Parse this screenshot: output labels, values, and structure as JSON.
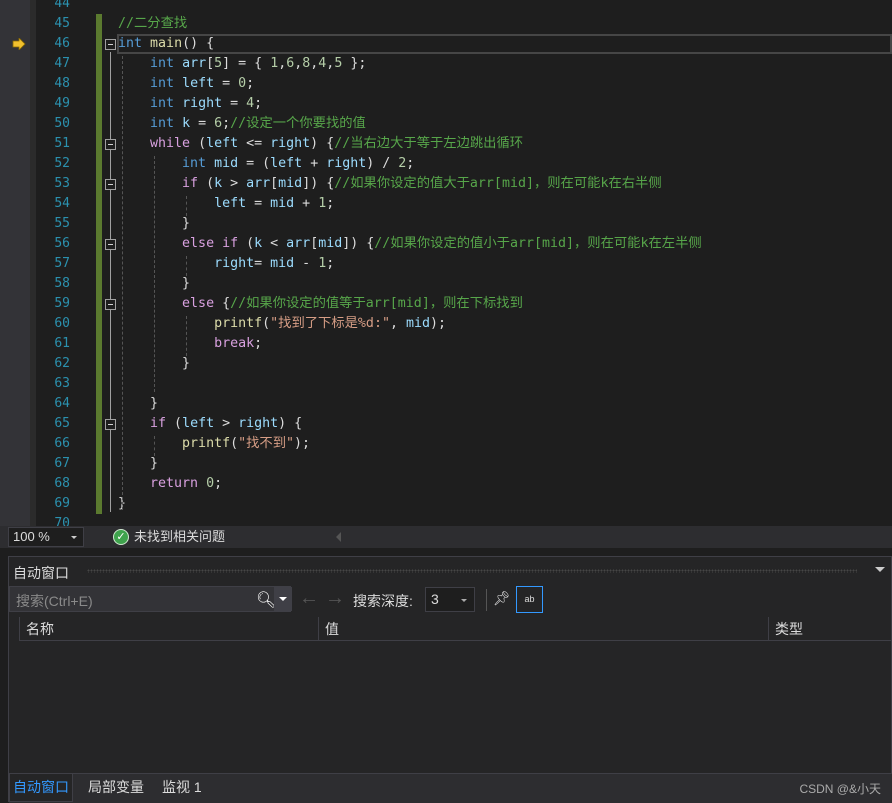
{
  "editor": {
    "first_line": 44,
    "current_line": 46,
    "lines": [
      [],
      [
        [
          "m",
          "//二分查找"
        ]
      ],
      [
        [
          "k",
          "int"
        ],
        [
          "p",
          " "
        ],
        [
          "f",
          "main"
        ],
        [
          "p",
          "() {"
        ]
      ],
      [
        [
          "p",
          "    "
        ],
        [
          "k",
          "int"
        ],
        [
          "p",
          " "
        ],
        [
          "v",
          "arr"
        ],
        [
          "p",
          "["
        ],
        [
          "n",
          "5"
        ],
        [
          "p",
          "] = { "
        ],
        [
          "n",
          "1"
        ],
        [
          "p",
          ","
        ],
        [
          "n",
          "6"
        ],
        [
          "p",
          ","
        ],
        [
          "n",
          "8"
        ],
        [
          "p",
          ","
        ],
        [
          "n",
          "4"
        ],
        [
          "p",
          ","
        ],
        [
          "n",
          "5"
        ],
        [
          "p",
          " };"
        ]
      ],
      [
        [
          "p",
          "    "
        ],
        [
          "k",
          "int"
        ],
        [
          "p",
          " "
        ],
        [
          "v",
          "left"
        ],
        [
          "p",
          " = "
        ],
        [
          "n",
          "0"
        ],
        [
          "p",
          ";"
        ]
      ],
      [
        [
          "p",
          "    "
        ],
        [
          "k",
          "int"
        ],
        [
          "p",
          " "
        ],
        [
          "v",
          "right"
        ],
        [
          "p",
          " = "
        ],
        [
          "n",
          "4"
        ],
        [
          "p",
          ";"
        ]
      ],
      [
        [
          "p",
          "    "
        ],
        [
          "k",
          "int"
        ],
        [
          "p",
          " "
        ],
        [
          "v",
          "k"
        ],
        [
          "p",
          " = "
        ],
        [
          "n",
          "6"
        ],
        [
          "p",
          ";"
        ],
        [
          "m",
          "//设定一个你要找的值"
        ]
      ],
      [
        [
          "p",
          "    "
        ],
        [
          "c",
          "while"
        ],
        [
          "p",
          " ("
        ],
        [
          "v",
          "left"
        ],
        [
          "p",
          " <= "
        ],
        [
          "v",
          "right"
        ],
        [
          "p",
          ") {"
        ],
        [
          "m",
          "//当右边大于等于左边跳出循环"
        ]
      ],
      [
        [
          "p",
          "        "
        ],
        [
          "k",
          "int"
        ],
        [
          "p",
          " "
        ],
        [
          "v",
          "mid"
        ],
        [
          "p",
          " = ("
        ],
        [
          "v",
          "left"
        ],
        [
          "p",
          " + "
        ],
        [
          "v",
          "right"
        ],
        [
          "p",
          ") / "
        ],
        [
          "n",
          "2"
        ],
        [
          "p",
          ";"
        ]
      ],
      [
        [
          "p",
          "        "
        ],
        [
          "c",
          "if"
        ],
        [
          "p",
          " ("
        ],
        [
          "v",
          "k"
        ],
        [
          "p",
          " > "
        ],
        [
          "v",
          "arr"
        ],
        [
          "p",
          "["
        ],
        [
          "v",
          "mid"
        ],
        [
          "p",
          "]) {"
        ],
        [
          "m",
          "//如果你设定的值大于arr[mid]，则在可能k在右半侧"
        ]
      ],
      [
        [
          "p",
          "            "
        ],
        [
          "v",
          "left"
        ],
        [
          "p",
          " = "
        ],
        [
          "v",
          "mid"
        ],
        [
          "p",
          " + "
        ],
        [
          "n",
          "1"
        ],
        [
          "p",
          ";"
        ]
      ],
      [
        [
          "p",
          "        }"
        ]
      ],
      [
        [
          "p",
          "        "
        ],
        [
          "c",
          "else if"
        ],
        [
          "p",
          " ("
        ],
        [
          "v",
          "k"
        ],
        [
          "p",
          " < "
        ],
        [
          "v",
          "arr"
        ],
        [
          "p",
          "["
        ],
        [
          "v",
          "mid"
        ],
        [
          "p",
          "]) {"
        ],
        [
          "m",
          "//如果你设定的值小于arr[mid]，则在可能k在左半侧"
        ]
      ],
      [
        [
          "p",
          "            "
        ],
        [
          "v",
          "right"
        ],
        [
          "p",
          "= "
        ],
        [
          "v",
          "mid"
        ],
        [
          "p",
          " - "
        ],
        [
          "n",
          "1"
        ],
        [
          "p",
          ";"
        ]
      ],
      [
        [
          "p",
          "        }"
        ]
      ],
      [
        [
          "p",
          "        "
        ],
        [
          "c",
          "else"
        ],
        [
          "p",
          " {"
        ],
        [
          "m",
          "//如果你设定的值等于arr[mid]，则在下标找到"
        ]
      ],
      [
        [
          "p",
          "            "
        ],
        [
          "f",
          "printf"
        ],
        [
          "p",
          "("
        ],
        [
          "s",
          "\"找到了下标是%d:\""
        ],
        [
          "p",
          ", "
        ],
        [
          "v",
          "mid"
        ],
        [
          "p",
          ");"
        ]
      ],
      [
        [
          "p",
          "            "
        ],
        [
          "c",
          "break"
        ],
        [
          "p",
          ";"
        ]
      ],
      [
        [
          "p",
          "        }"
        ]
      ],
      [],
      [
        [
          "p",
          "    }"
        ]
      ],
      [
        [
          "p",
          "    "
        ],
        [
          "c",
          "if"
        ],
        [
          "p",
          " ("
        ],
        [
          "v",
          "left"
        ],
        [
          "p",
          " > "
        ],
        [
          "v",
          "right"
        ],
        [
          "p",
          ") {"
        ]
      ],
      [
        [
          "p",
          "        "
        ],
        [
          "f",
          "printf"
        ],
        [
          "p",
          "("
        ],
        [
          "s",
          "\"找不到\""
        ],
        [
          "p",
          ");"
        ]
      ],
      [
        [
          "p",
          "    }"
        ]
      ],
      [
        [
          "p",
          "    "
        ],
        [
          "c",
          "return"
        ],
        [
          "p",
          " "
        ],
        [
          "n",
          "0"
        ],
        [
          "p",
          ";"
        ]
      ],
      [
        [
          "p",
          "}"
        ]
      ],
      []
    ]
  },
  "statusbar": {
    "zoom": "100 %",
    "issues": "未找到相关问题"
  },
  "panel": {
    "title": "自动窗口",
    "search_placeholder": "搜索(Ctrl+E)",
    "depth_label": "搜索深度:",
    "depth_value": "3",
    "columns": [
      "名称",
      "值",
      "类型"
    ],
    "tabs": [
      {
        "label": "自动窗口",
        "active": true
      },
      {
        "label": "局部变量"
      },
      {
        "label": "监视 1"
      }
    ],
    "watermark": "CSDN @&小天"
  },
  "colors": {
    "accent": "#3399ff",
    "keyword": "#569cd6",
    "control": "#d8a0df",
    "comment": "#57a64a",
    "string": "#d69d85"
  }
}
